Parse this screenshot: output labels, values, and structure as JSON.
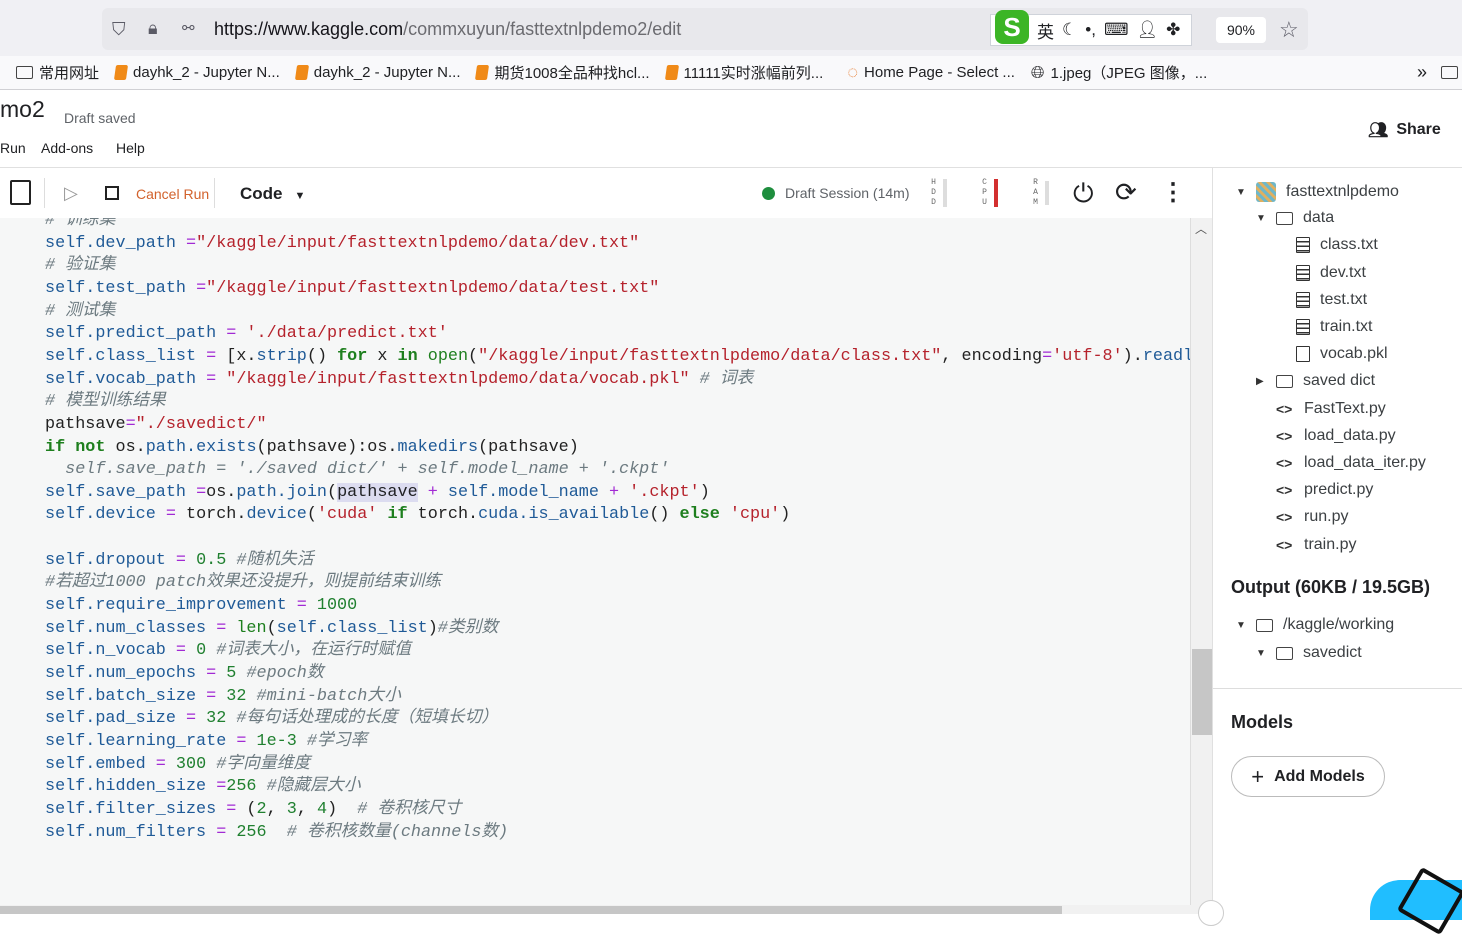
{
  "browser": {
    "url_host": "https://www.kaggle.com",
    "url_path": "/commxuyun/fasttextnlpdemo2/edit",
    "zoom": "90%",
    "ime": {
      "logo": "S",
      "lang": "英"
    },
    "bookmarks": [
      {
        "label": "常用网址",
        "icon": "folder"
      },
      {
        "label": "dayhk_2 - Jupyter N...",
        "icon": "jupyter"
      },
      {
        "label": "dayhk_2 - Jupyter N...",
        "icon": "jupyter"
      },
      {
        "label": "期货1008全品种找hcl...",
        "icon": "jupyter"
      },
      {
        "label": "11111实时涨幅前列...",
        "icon": "jupyter"
      },
      {
        "label": "Home Page - Select ...",
        "icon": "orange-ring"
      },
      {
        "label": "1.jpeg（JPEG 图像，...",
        "icon": "globe"
      }
    ]
  },
  "header": {
    "title": "mo2",
    "status": "Draft saved",
    "menu": [
      "Run",
      "Add-ons",
      "Help"
    ],
    "share": "Share"
  },
  "toolbar": {
    "cancel_run": "Cancel Run",
    "cell_type": "Code",
    "session": "Draft Session (14m)",
    "meters": [
      {
        "label": "HDD"
      },
      {
        "label": "CPU",
        "color": "#d32f2f"
      },
      {
        "label": "RAM"
      }
    ]
  },
  "code_lines": [
    [
      [
        "c",
        "# 训练集"
      ]
    ],
    [
      [
        "s",
        "self.dev_path "
      ],
      [
        "op",
        "="
      ],
      [
        "st",
        "\"/kaggle/input/fasttextnlpdemo/data/dev.txt\""
      ]
    ],
    [
      [
        "c",
        "# 验证集"
      ]
    ],
    [
      [
        "s",
        "self.test_path "
      ],
      [
        "op",
        "="
      ],
      [
        "st",
        "\"/kaggle/input/fasttextnlpdemo/data/test.txt\""
      ]
    ],
    [
      [
        "c",
        "# 测试集"
      ]
    ],
    [
      [
        "s",
        "self.predict_path "
      ],
      [
        "op",
        "="
      ],
      [
        "st",
        " './data/predict.txt'"
      ]
    ],
    [
      [
        "s",
        "self.class_list "
      ],
      [
        "op",
        "="
      ],
      [
        "t",
        " [x."
      ],
      [
        "s",
        "strip"
      ],
      [
        "t",
        "() "
      ],
      [
        "k",
        "for"
      ],
      [
        "t",
        " x "
      ],
      [
        "k",
        "in"
      ],
      [
        "f",
        " open"
      ],
      [
        "t",
        "("
      ],
      [
        "st",
        "\"/kaggle/input/fasttextnlpdemo/data/class.txt\""
      ],
      [
        "t",
        ", encoding"
      ],
      [
        "op",
        "="
      ],
      [
        "st",
        "'utf-8'"
      ],
      [
        "t",
        ")."
      ],
      [
        "s",
        "readlines()"
      ]
    ],
    [
      [
        "s",
        "self.vocab_path "
      ],
      [
        "op",
        "="
      ],
      [
        "st",
        " \"/kaggle/input/fasttextnlpdemo/data/vocab.pkl\""
      ],
      [
        "c",
        " # 词表"
      ]
    ],
    [
      [
        "c",
        "# 模型训练结果"
      ]
    ],
    [
      [
        "t",
        "pathsave"
      ],
      [
        "op",
        "="
      ],
      [
        "st",
        "\"./savedict/\""
      ]
    ],
    [
      [
        "k",
        "if not"
      ],
      [
        "t",
        " os."
      ],
      [
        "s",
        "path.exists"
      ],
      [
        "t",
        "(pathsave):os."
      ],
      [
        "s",
        "makedirs"
      ],
      [
        "t",
        "(pathsave)"
      ]
    ],
    [
      [
        "c",
        "  self.save_path = './saved dict/' + self.model_name + '.ckpt'"
      ]
    ],
    [
      [
        "s",
        "self.save_path "
      ],
      [
        "op",
        "="
      ],
      [
        "t",
        "os."
      ],
      [
        "s",
        "path.join"
      ],
      [
        "t",
        "("
      ],
      [
        "hl",
        "pathsave"
      ],
      [
        "op",
        " +"
      ],
      [
        "s",
        " self.model_name"
      ],
      [
        "op",
        " +"
      ],
      [
        "st",
        " '.ckpt'"
      ],
      [
        "t",
        ")"
      ]
    ],
    [
      [
        "s",
        "self.device "
      ],
      [
        "op",
        "="
      ],
      [
        "t",
        " torch."
      ],
      [
        "s",
        "device"
      ],
      [
        "t",
        "("
      ],
      [
        "st",
        "'cuda'"
      ],
      [
        "k",
        " if"
      ],
      [
        "t",
        " torch."
      ],
      [
        "s",
        "cuda.is_available"
      ],
      [
        "t",
        "() "
      ],
      [
        "k",
        "else"
      ],
      [
        "st",
        " 'cpu'"
      ],
      [
        "t",
        ")"
      ]
    ],
    [],
    [
      [
        "s",
        "self.dropout "
      ],
      [
        "op",
        "="
      ],
      [
        "n",
        " 0.5"
      ],
      [
        "c",
        " #随机失活"
      ]
    ],
    [
      [
        "c",
        "#若超过1000 patch效果还没提升，则提前结束训练"
      ]
    ],
    [
      [
        "s",
        "self.require_improvement "
      ],
      [
        "op",
        "="
      ],
      [
        "n",
        " 1000"
      ]
    ],
    [
      [
        "s",
        "self.num_classes "
      ],
      [
        "op",
        "="
      ],
      [
        "f",
        " len"
      ],
      [
        "t",
        "("
      ],
      [
        "s",
        "self.class_list"
      ],
      [
        "t",
        ")"
      ],
      [
        "c",
        "#类别数"
      ]
    ],
    [
      [
        "s",
        "self.n_vocab "
      ],
      [
        "op",
        "="
      ],
      [
        "n",
        " 0"
      ],
      [
        "c",
        " #词表大小，在运行时赋值"
      ]
    ],
    [
      [
        "s",
        "self.num_epochs "
      ],
      [
        "op",
        "="
      ],
      [
        "n",
        " 5"
      ],
      [
        "c",
        " #epoch数"
      ]
    ],
    [
      [
        "s",
        "self.batch_size "
      ],
      [
        "op",
        "="
      ],
      [
        "n",
        " 32"
      ],
      [
        "c",
        " #mini-batch大小"
      ]
    ],
    [
      [
        "s",
        "self.pad_size "
      ],
      [
        "op",
        "="
      ],
      [
        "n",
        " 32"
      ],
      [
        "c",
        " #每句话处理成的长度（短填长切）"
      ]
    ],
    [
      [
        "s",
        "self.learning_rate "
      ],
      [
        "op",
        "="
      ],
      [
        "n",
        " 1e-3"
      ],
      [
        "c",
        " #学习率"
      ]
    ],
    [
      [
        "s",
        "self.embed "
      ],
      [
        "op",
        "="
      ],
      [
        "n",
        " 300"
      ],
      [
        "c",
        " #字向量维度"
      ]
    ],
    [
      [
        "s",
        "self.hidden_size "
      ],
      [
        "op",
        "="
      ],
      [
        "n",
        "256"
      ],
      [
        "c",
        " #隐藏层大小"
      ]
    ],
    [
      [
        "s",
        "self.filter_sizes "
      ],
      [
        "op",
        "="
      ],
      [
        "t",
        " ("
      ],
      [
        "n",
        "2"
      ],
      [
        "t",
        ", "
      ],
      [
        "n",
        "3"
      ],
      [
        "t",
        ", "
      ],
      [
        "n",
        "4"
      ],
      [
        "t",
        ")"
      ],
      [
        "c",
        "  # 卷积核尺寸"
      ]
    ],
    [
      [
        "s",
        "self.num_filters "
      ],
      [
        "op",
        "="
      ],
      [
        "n",
        " 256"
      ],
      [
        "c",
        "  # 卷积核数量(channels数)"
      ]
    ]
  ],
  "sidebar": {
    "input_tree": [
      {
        "label": "fasttextnlpdemo",
        "icon": "dataset",
        "level": 0,
        "caret": "down"
      },
      {
        "label": "data",
        "icon": "folder",
        "level": 1,
        "caret": "down"
      },
      {
        "label": "class.txt",
        "icon": "file-text",
        "level": 2
      },
      {
        "label": "dev.txt",
        "icon": "file-text",
        "level": 2
      },
      {
        "label": "test.txt",
        "icon": "file-text",
        "level": 2
      },
      {
        "label": "train.txt",
        "icon": "file-text",
        "level": 2
      },
      {
        "label": "vocab.pkl",
        "icon": "file",
        "level": 2
      },
      {
        "label": "saved dict",
        "icon": "folder",
        "level": 1,
        "caret": "right"
      },
      {
        "label": "FastText.py",
        "icon": "code",
        "level": 1
      },
      {
        "label": "load_data.py",
        "icon": "code",
        "level": 1
      },
      {
        "label": "load_data_iter.py",
        "icon": "code",
        "level": 1
      },
      {
        "label": "predict.py",
        "icon": "code",
        "level": 1
      },
      {
        "label": "run.py",
        "icon": "code",
        "level": 1
      },
      {
        "label": "train.py",
        "icon": "code",
        "level": 1
      }
    ],
    "output_title": "Output (60KB / 19.5GB)",
    "output_tree": [
      {
        "label": "/kaggle/working",
        "icon": "folder",
        "level": 0,
        "caret": "down"
      },
      {
        "label": "savedict",
        "icon": "folder",
        "level": 1,
        "caret": "down"
      }
    ],
    "models_title": "Models",
    "add_models": "Add Models"
  }
}
